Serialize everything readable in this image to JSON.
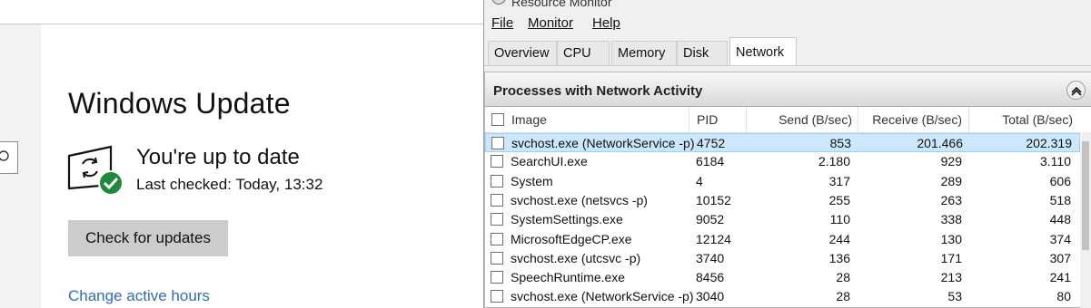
{
  "settings": {
    "title": "Windows Update",
    "status_title": "You're up to date",
    "status_sub": "Last checked: Today, 13:32",
    "check_button": "Check for updates",
    "link_active_hours": "Change active hours"
  },
  "resmon": {
    "window_title": "Resource Monitor",
    "menu": {
      "file": "File",
      "monitor": "Monitor",
      "help": "Help"
    },
    "tabs": [
      "Overview",
      "CPU",
      "Memory",
      "Disk",
      "Network"
    ],
    "active_tab": "Network",
    "panel_title": "Processes with Network Activity",
    "columns": {
      "image": "Image",
      "pid": "PID",
      "send": "Send (B/sec)",
      "receive": "Receive (B/sec)",
      "total": "Total (B/sec)"
    },
    "rows": [
      {
        "image": "svchost.exe (NetworkService -p)",
        "pid": "4752",
        "send": "853",
        "receive": "201.466",
        "total": "202.319",
        "selected": true
      },
      {
        "image": "SearchUI.exe",
        "pid": "6184",
        "send": "2.180",
        "receive": "929",
        "total": "3.110"
      },
      {
        "image": "System",
        "pid": "4",
        "send": "317",
        "receive": "289",
        "total": "606"
      },
      {
        "image": "svchost.exe (netsvcs -p)",
        "pid": "10152",
        "send": "255",
        "receive": "263",
        "total": "518"
      },
      {
        "image": "SystemSettings.exe",
        "pid": "9052",
        "send": "110",
        "receive": "338",
        "total": "448"
      },
      {
        "image": "MicrosoftEdgeCP.exe",
        "pid": "12124",
        "send": "244",
        "receive": "130",
        "total": "374"
      },
      {
        "image": "svchost.exe (utcsvc -p)",
        "pid": "3740",
        "send": "136",
        "receive": "171",
        "total": "307"
      },
      {
        "image": "SpeechRuntime.exe",
        "pid": "8456",
        "send": "28",
        "receive": "213",
        "total": "241"
      },
      {
        "image": "svchost.exe (NetworkService -p)",
        "pid": "3040",
        "send": "28",
        "receive": "53",
        "total": "80"
      }
    ]
  },
  "colors": {
    "link": "#2f6db5",
    "selection": "#cce8ff",
    "badge_green": "#1e8a3e"
  }
}
